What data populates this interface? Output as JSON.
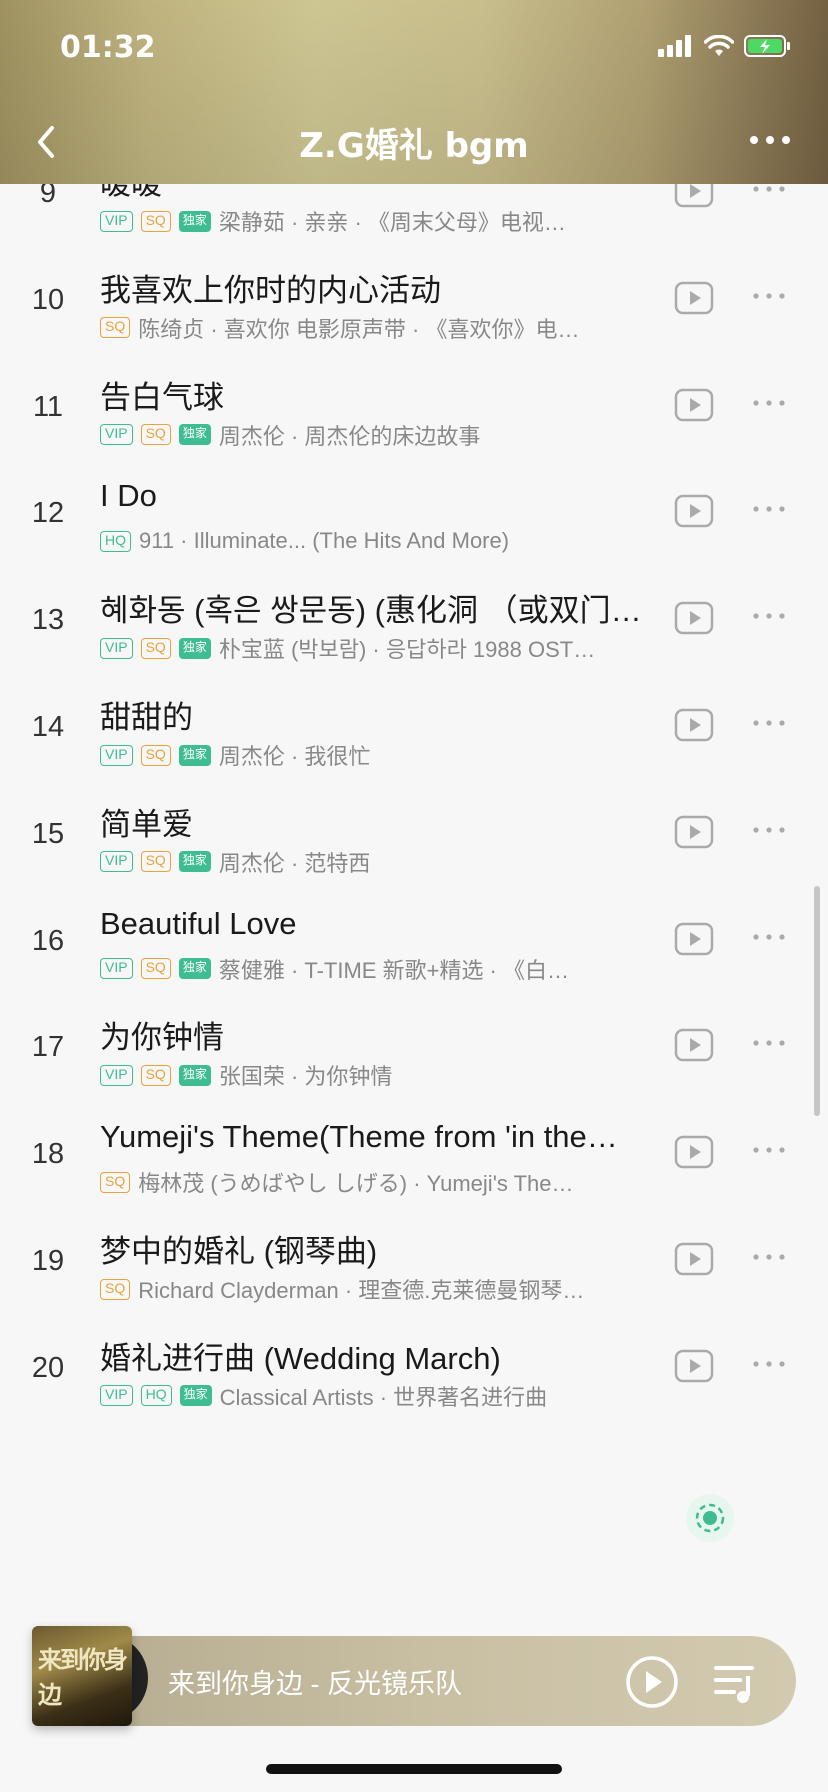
{
  "status": {
    "time": "01:32"
  },
  "header": {
    "title": "Z.G婚礼 bgm"
  },
  "songs": [
    {
      "num": "9",
      "title": "暖暖",
      "badges": [
        "VIP",
        "SQ",
        "独家"
      ],
      "artist": "梁静茹 · 亲亲 · 《周末父母》电视…"
    },
    {
      "num": "10",
      "title": "我喜欢上你时的内心活动",
      "badges": [
        "SQ"
      ],
      "artist": "陈绮贞 · 喜欢你 电影原声带 · 《喜欢你》电…"
    },
    {
      "num": "11",
      "title": "告白气球",
      "badges": [
        "VIP",
        "SQ",
        "独家"
      ],
      "artist": "周杰伦 · 周杰伦的床边故事"
    },
    {
      "num": "12",
      "title": "I Do",
      "badges": [
        "HQ"
      ],
      "artist": "911 · Illuminate... (The Hits And More)"
    },
    {
      "num": "13",
      "title": "혜화동 (혹은 쌍문동) (惠化洞 （或双门…",
      "badges": [
        "VIP",
        "SQ",
        "独家"
      ],
      "artist": "朴宝蓝 (박보람) · 응답하라 1988 OST…"
    },
    {
      "num": "14",
      "title": "甜甜的",
      "badges": [
        "VIP",
        "SQ",
        "独家"
      ],
      "artist": "周杰伦 · 我很忙"
    },
    {
      "num": "15",
      "title": "简单爱",
      "badges": [
        "VIP",
        "SQ",
        "独家"
      ],
      "artist": "周杰伦 · 范特西"
    },
    {
      "num": "16",
      "title": "Beautiful Love",
      "badges": [
        "VIP",
        "SQ",
        "独家"
      ],
      "artist": "蔡健雅 · T-TIME 新歌+精选 · 《白…"
    },
    {
      "num": "17",
      "title": "为你钟情",
      "badges": [
        "VIP",
        "SQ",
        "独家"
      ],
      "artist": "张国荣 · 为你钟情"
    },
    {
      "num": "18",
      "title": "Yumeji's Theme(Theme from 'in the…",
      "badges": [
        "SQ"
      ],
      "artist": "梅林茂 (うめばやし しげる) · Yumeji's The…"
    },
    {
      "num": "19",
      "title": "梦中的婚礼 (钢琴曲)",
      "badges": [
        "SQ"
      ],
      "artist": "Richard Clayderman · 理查德.克莱德曼钢琴…"
    },
    {
      "num": "20",
      "title": "婚礼进行曲 (Wedding March)",
      "badges": [
        "VIP",
        "HQ",
        "独家"
      ],
      "artist": "Classical Artists · 世界著名进行曲"
    }
  ],
  "player": {
    "now_playing": "来到你身边 - 反光镜乐队",
    "album_art_text": "来到你身边"
  },
  "icons": {
    "back": "chevron-left-icon",
    "more": "more-horizontal-icon",
    "play": "play-video-icon",
    "list": "playlist-icon"
  },
  "colors": {
    "accent": "#3ebd93",
    "sq": "#e8a33d"
  }
}
